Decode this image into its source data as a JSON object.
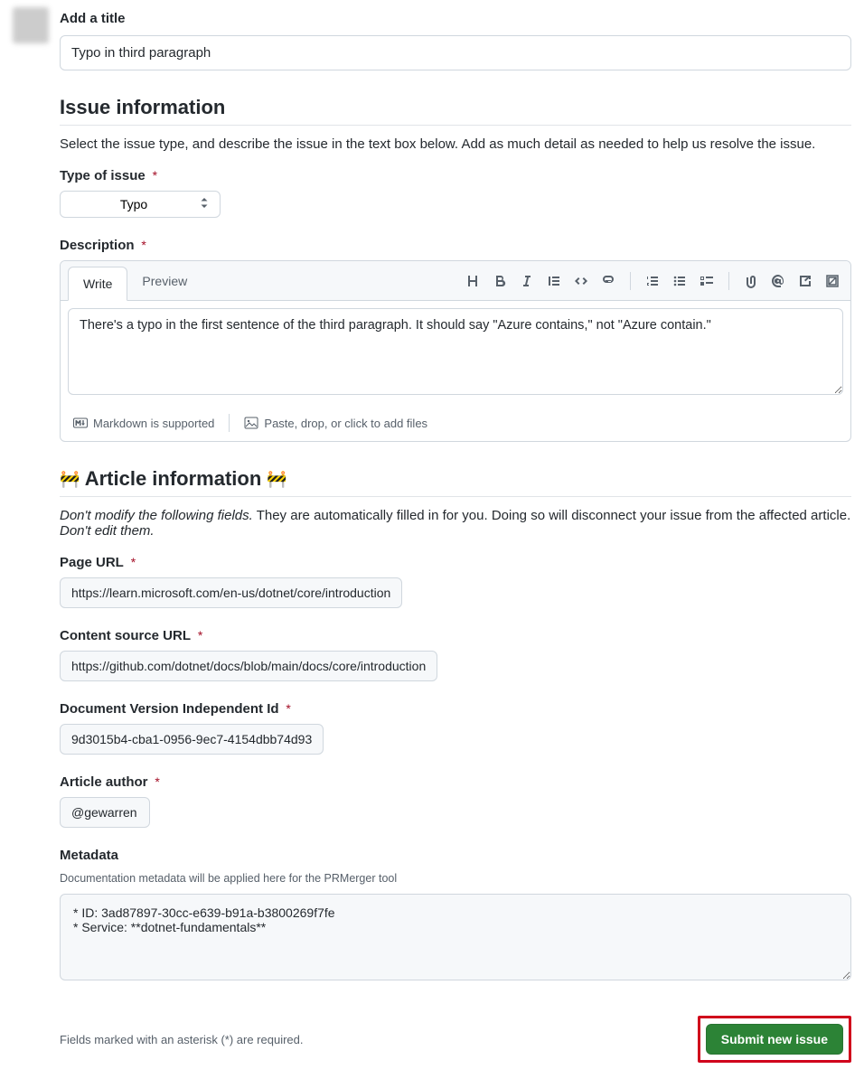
{
  "title": {
    "label": "Add a title",
    "value": "Typo in third paragraph"
  },
  "issue_info": {
    "heading": "Issue information",
    "desc": "Select the issue type, and describe the issue in the text box below. Add as much detail as needed to help us resolve the issue.",
    "type_label": "Type of issue",
    "type_value": "Typo",
    "description_label": "Description"
  },
  "editor": {
    "tab_write": "Write",
    "tab_preview": "Preview",
    "text": "There's a typo in the first sentence of the third paragraph. It should say \"Azure contains,\" not \"Azure contain.\"",
    "markdown_note": "Markdown is supported",
    "attach_note": "Paste, drop, or click to add files"
  },
  "article_info": {
    "heading_pre": "🚧",
    "heading_text": "Article information",
    "heading_post": "🚧",
    "desc_em1": "Don't modify the following fields.",
    "desc_mid": " They are automatically filled in for you. Doing so will disconnect your issue from the affected article. ",
    "desc_em2": "Don't edit them."
  },
  "fields": {
    "page_url_label": "Page URL",
    "page_url_value": "https://learn.microsoft.com/en-us/dotnet/core/introduction",
    "content_source_label": "Content source URL",
    "content_source_value": "https://github.com/dotnet/docs/blob/main/docs/core/introduction",
    "doc_version_label": "Document Version Independent Id",
    "doc_version_value": "9d3015b4-cba1-0956-9ec7-4154dbb74d93",
    "author_label": "Article author",
    "author_value": "@gewarren",
    "metadata_label": "Metadata",
    "metadata_sub": "Documentation metadata will be applied here for the PRMerger tool",
    "metadata_value": "* ID: 3ad87897-30cc-e639-b91a-b3800269f7fe\n* Service: **dotnet-fundamentals**"
  },
  "footer": {
    "required_note": "Fields marked with an asterisk (*) are required.",
    "submit_label": "Submit new issue"
  },
  "asterisk": "*"
}
